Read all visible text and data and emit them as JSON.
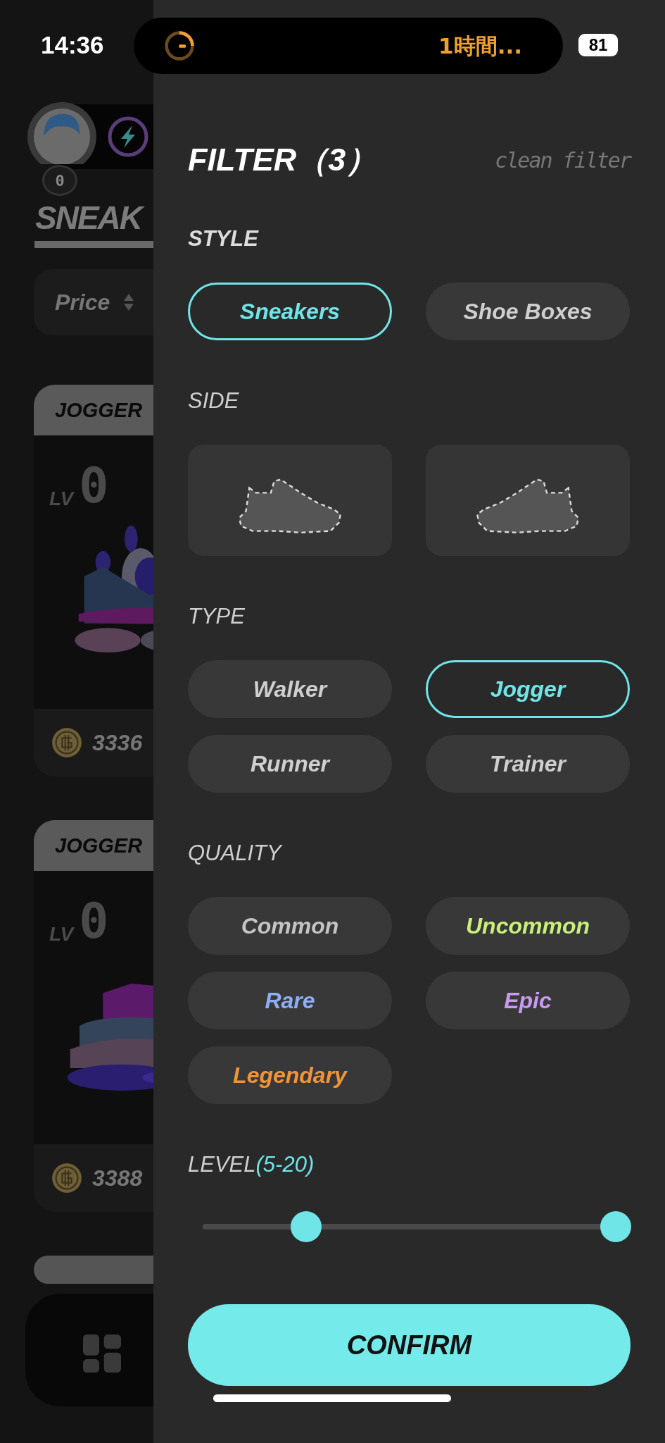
{
  "status_bar": {
    "time": "14:36",
    "activity": "1時間...",
    "battery": "81"
  },
  "background": {
    "avatar_badge": "0",
    "header": "SNEAK",
    "sort": {
      "label": "Price"
    },
    "cards": [
      {
        "category": "JOGGER",
        "lv_label": "LV",
        "lv_value": "0",
        "price": "3336"
      },
      {
        "category": "JOGGER",
        "lv_label": "LV",
        "lv_value": "0",
        "price": "3388"
      }
    ]
  },
  "filter": {
    "title": "FILTER（3）",
    "clear": "clean filter",
    "style": {
      "label": "STYLE",
      "options": [
        {
          "label": "Sneakers",
          "selected": true
        },
        {
          "label": "Shoe Boxes",
          "selected": false
        }
      ]
    },
    "side": {
      "label": "SIDE",
      "options": [
        {
          "kind": "right",
          "selected": false
        },
        {
          "kind": "left",
          "selected": false
        }
      ]
    },
    "type": {
      "label": "TYPE",
      "options": [
        {
          "label": "Walker",
          "selected": false
        },
        {
          "label": "Jogger",
          "selected": true
        },
        {
          "label": "Runner",
          "selected": false
        },
        {
          "label": "Trainer",
          "selected": false
        }
      ]
    },
    "quality": {
      "label": "QUALITY",
      "options": [
        {
          "label": "Common",
          "selected": false,
          "color": "#c4c4c4"
        },
        {
          "label": "Uncommon",
          "selected": false,
          "color": "#c8f07a"
        },
        {
          "label": "Rare",
          "selected": false,
          "color": "#8fadf5"
        },
        {
          "label": "Epic",
          "selected": false,
          "color": "#c99af2"
        },
        {
          "label": "Legendary",
          "selected": false,
          "color": "#f0943a"
        }
      ]
    },
    "level": {
      "label": "LEVEL",
      "range": "(5-20)",
      "low": {
        "level": 0.25
      },
      "high": {
        "level": 1.0
      }
    },
    "confirm": "CONFIRM"
  }
}
